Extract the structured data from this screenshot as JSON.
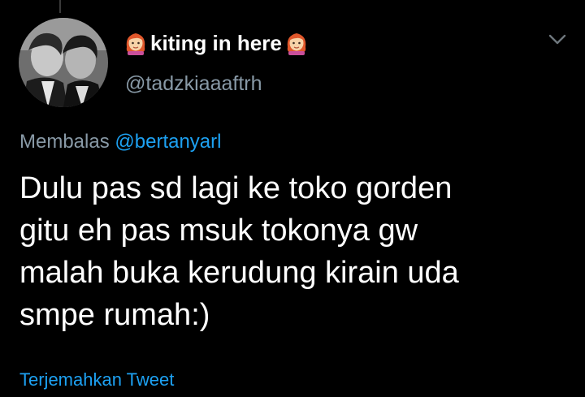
{
  "tweet": {
    "display_name": "kiting in here",
    "handle": "@tadzkiaaaftrh",
    "reply_prefix": "Membalas",
    "reply_to": "@bertanyarl",
    "text_lines": [
      "Dulu pas sd lagi ke toko gorden",
      "gitu eh pas msuk tokonya gw",
      "malah buka kerudung kirain uda",
      "smpe rumah:)"
    ],
    "translate_label": "Terjemahkan Tweet",
    "name_icons": [
      "woman-red-hair-emoji",
      "woman-red-hair-emoji"
    ]
  },
  "colors": {
    "background": "#000000",
    "primary_text": "#ffffff",
    "secondary_text": "#8899a6",
    "link": "#1da1f2"
  }
}
